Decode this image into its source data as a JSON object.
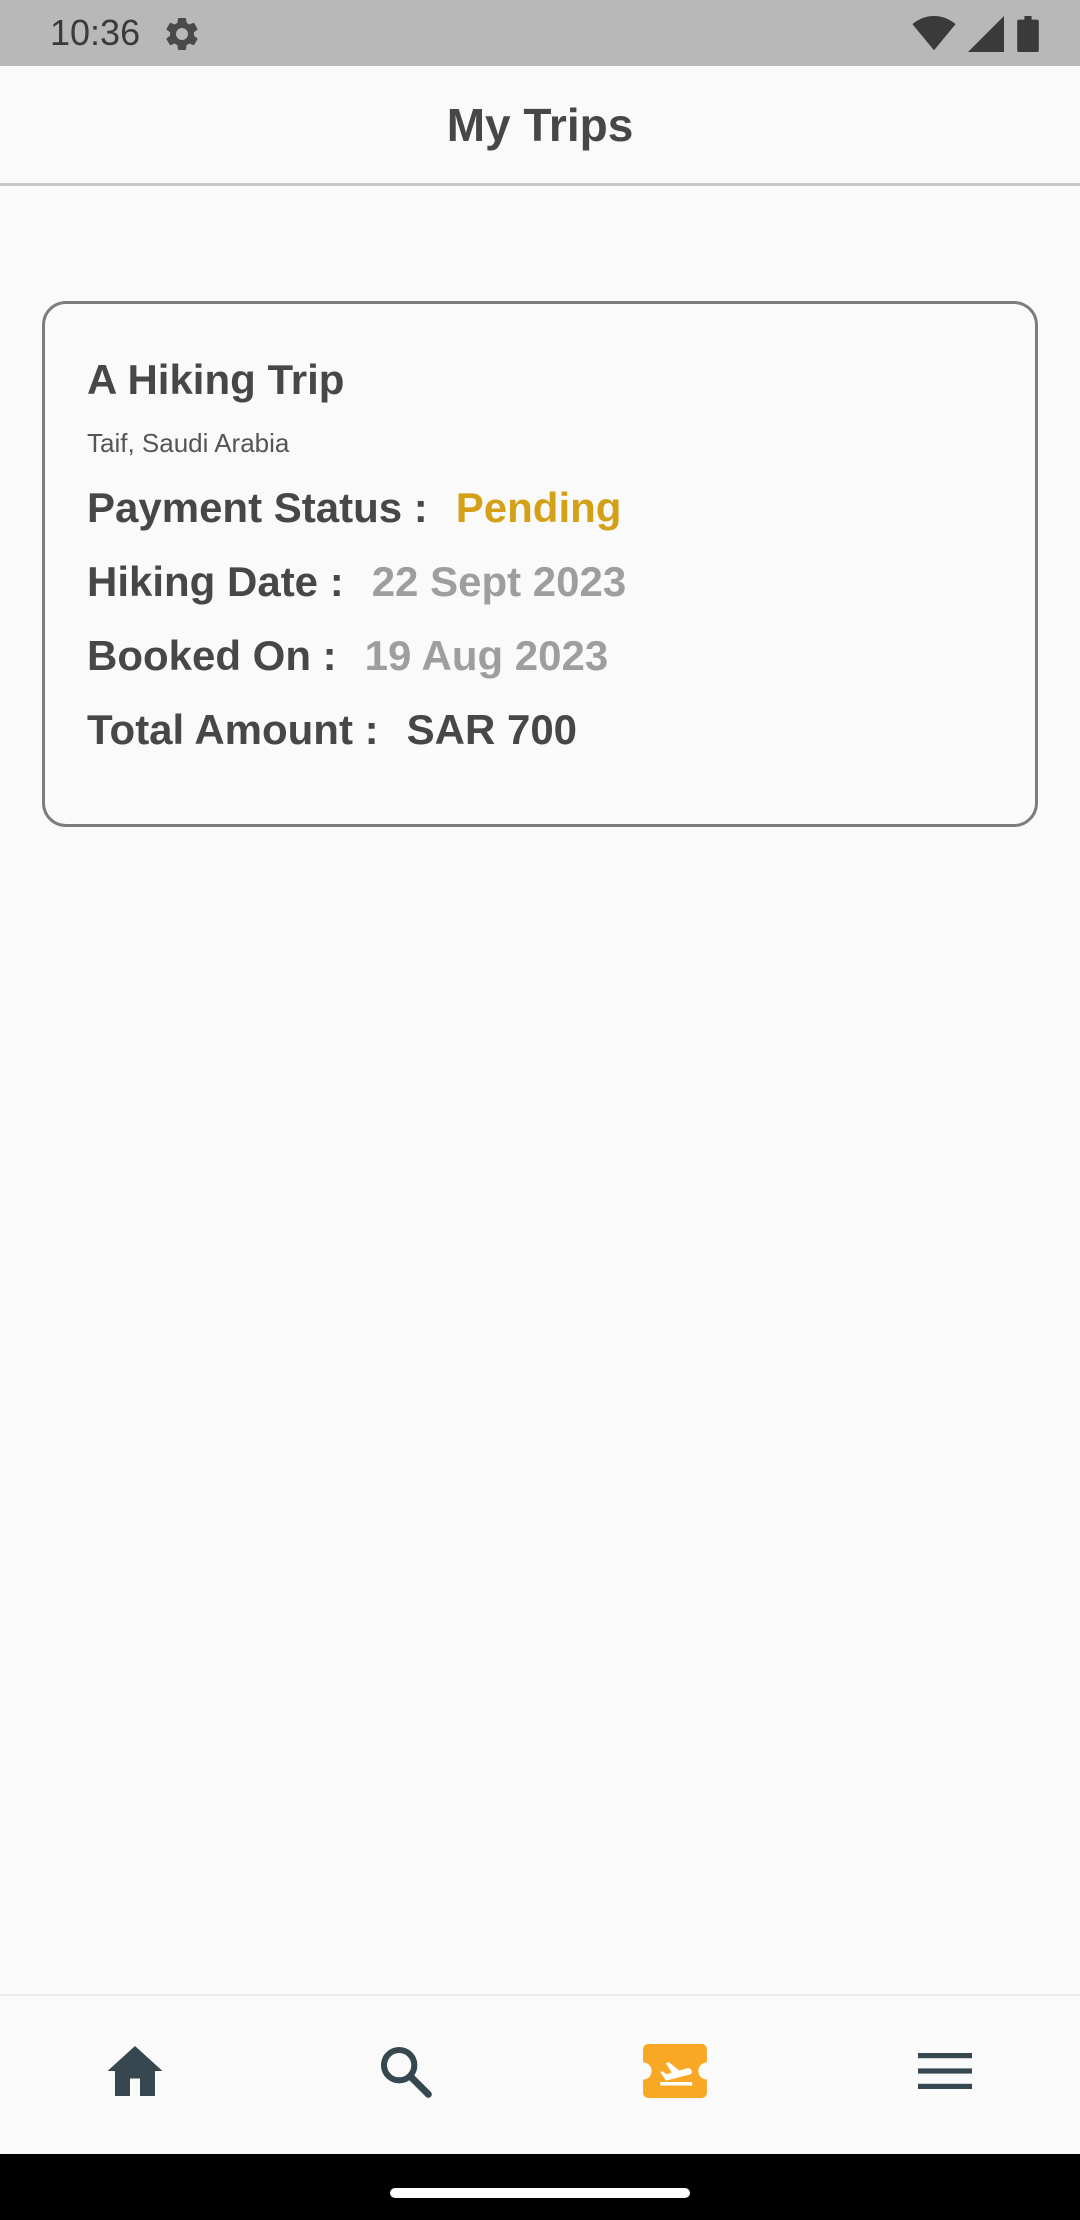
{
  "status_bar": {
    "time": "10:36",
    "icons": [
      "settings-gear-icon",
      "wifi-icon",
      "signal-icon",
      "battery-icon"
    ]
  },
  "app_bar": {
    "title": "My Trips"
  },
  "trip": {
    "title": "A Hiking Trip",
    "location": "Taif, Saudi Arabia",
    "payment_status_label": "Payment Status :",
    "payment_status_value": "Pending",
    "hiking_date_label": "Hiking Date :",
    "hiking_date_value": "22 Sept 2023",
    "booked_on_label": "Booked On :",
    "booked_on_value": "19 Aug 2023",
    "total_amount_label": "Total Amount :",
    "total_amount_value": "SAR 700"
  },
  "bottom_nav": {
    "items": [
      {
        "icon": "home-icon",
        "active": false
      },
      {
        "icon": "search-icon",
        "active": false
      },
      {
        "icon": "trips-ticket-icon",
        "active": true
      },
      {
        "icon": "menu-icon",
        "active": false
      }
    ]
  },
  "colors": {
    "accent": "#f9a825",
    "pending": "#d4a017",
    "nav_icon": "#37474f",
    "text_dark": "#474747",
    "text_gray": "#9e9e9e"
  }
}
